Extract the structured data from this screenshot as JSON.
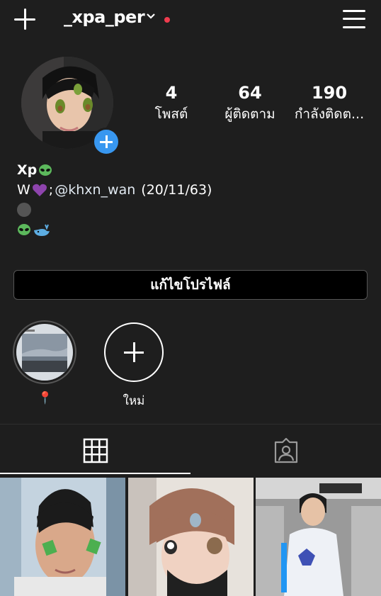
{
  "header": {
    "username": "_xpa_per"
  },
  "profile": {
    "stats": [
      {
        "value": "4",
        "label": "โพสต์"
      },
      {
        "value": "64",
        "label": "ผู้ติดตาม"
      },
      {
        "value": "190",
        "label": "กำลังติดต..."
      }
    ],
    "bio": {
      "name": "Xp",
      "line1_prefix": "W",
      "line1_sep": ";",
      "mention": "@khxn_wan",
      "line1_suffix": " (20/11/63)"
    },
    "edit_label": "แก้ไขโปรไฟล์"
  },
  "highlights": [
    {
      "label": "📍"
    },
    {
      "label": "ใหม่"
    }
  ],
  "colors": {
    "accent": "#3897f0",
    "notification": "#ef3c4e",
    "background": "#1e1e1e"
  }
}
